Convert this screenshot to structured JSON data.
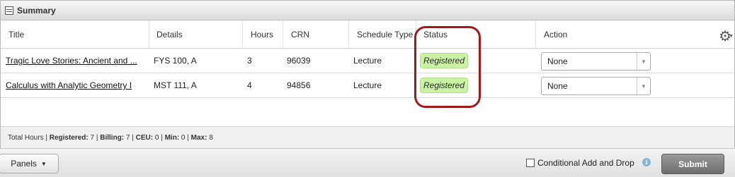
{
  "panel": {
    "title": "Summary"
  },
  "columns": {
    "title": "Title",
    "details": "Details",
    "hours": "Hours",
    "crn": "CRN",
    "schedule_type": "Schedule Type",
    "status": "Status",
    "action": "Action"
  },
  "rows": [
    {
      "title": "Tragic Love Stories: Ancient and ...",
      "details": "FYS 100, A",
      "hours": "3",
      "crn": "96039",
      "schedule_type": "Lecture",
      "status": "Registered",
      "action": "None"
    },
    {
      "title": "Calculus with Analytic Geometry I",
      "details": "MST 111, A",
      "hours": "4",
      "crn": "94856",
      "schedule_type": "Lecture",
      "status": "Registered",
      "action": "None"
    }
  ],
  "totals": {
    "total_hours_label": "Total Hours |",
    "registered_label": "Registered:",
    "registered_value": "7",
    "billing_label": "Billing:",
    "billing_value": "7",
    "ceu_label": "CEU:",
    "ceu_value": "0",
    "min_label": "Min:",
    "min_value": "0",
    "max_label": "Max:",
    "max_value": "8"
  },
  "footer": {
    "panels_label": "Panels",
    "conditional_label": "Conditional Add and Drop",
    "conditional_checked": false,
    "submit_label": "Submit"
  },
  "colors": {
    "status_badge": "#c9f2a4",
    "highlight": "#a31818"
  },
  "icons": [
    "summary-icon",
    "gear-icon",
    "chevron-down-icon",
    "info-icon"
  ]
}
